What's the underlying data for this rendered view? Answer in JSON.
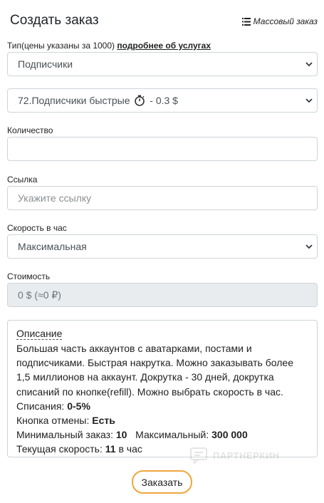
{
  "header": {
    "title": "Создать заказ",
    "bulk_order_label": "Массовый заказ"
  },
  "type_section": {
    "label": "Тип(цены указаны за 1000)",
    "more_link": "подробнее об услугах",
    "category_selected": "Подписчики",
    "service_prefix": "72.Подписчики быстрые",
    "service_price": "- 0.3 $"
  },
  "quantity": {
    "label": "Количество",
    "value": ""
  },
  "link": {
    "label": "Ссылка",
    "placeholder": "Укажите ссылку"
  },
  "speed": {
    "label": "Скорость в час",
    "selected": "Максимальная"
  },
  "cost": {
    "label": "Стоимость",
    "value": "0 $ (≈0 ₽)"
  },
  "description": {
    "title": "Описание",
    "text": "Большая часть аккаунтов с аватарками, постами и подписчиками. Быстрая накрутка. Можно заказывать более 1,5 миллионов на аккаунт. Докрутка - 30 дней, докрутка списаний по кнопке(refill). Можно выбрать скорость в час.",
    "writeoffs_label": "Списания:",
    "writeoffs_value": "0-5%",
    "cancel_label": "Кнопка отмены:",
    "cancel_value": "Есть",
    "min_label": "Минимальный заказ:",
    "min_value": "10",
    "max_label": "Максимальный:",
    "max_value": "300 000",
    "speed_label": "Текущая скорость:",
    "speed_value": "11",
    "speed_unit": "в час"
  },
  "watermark": "ПАРТНЕРКИН",
  "submit_label": "Заказать"
}
